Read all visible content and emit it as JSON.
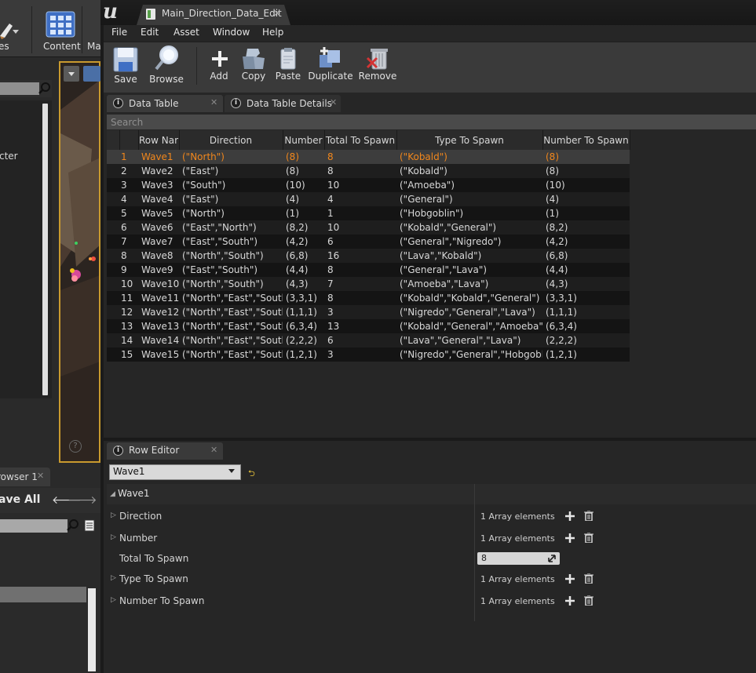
{
  "background_editor": {
    "toolbar_left_label": "es",
    "content_label": "Content",
    "ma_label": "Ma",
    "outliner_text": "cter",
    "viewport_help": "?",
    "browser_tab_label": "rowser 1",
    "browser_tab_close": "✕",
    "save_all_label": "ave All",
    "nav_back": "🡐",
    "nav_forward": "🡒"
  },
  "window": {
    "document_tab_title": "Main_Direction_Data_Edit",
    "document_tab_close": "✕"
  },
  "menu": [
    "File",
    "Edit",
    "Asset",
    "Window",
    "Help"
  ],
  "toolbar": {
    "save": "Save",
    "browse": "Browse",
    "add": "Add",
    "copy": "Copy",
    "paste": "Paste",
    "duplicate": "Duplicate",
    "remove": "Remove"
  },
  "panel_tabs": [
    {
      "label": "Data Table",
      "close": "✕"
    },
    {
      "label": "Data Table Details",
      "close": "✕"
    }
  ],
  "search": {
    "placeholder": "Search"
  },
  "table": {
    "columns": [
      "",
      "",
      "Row Nar",
      "Direction",
      "Number",
      "Total To Spawn",
      "Type To Spawn",
      "Number To Spawn"
    ],
    "rows": [
      [
        "1",
        "Wave1",
        "(\"North\")",
        "(8)",
        "8",
        "(\"Kobald\")",
        "(8)"
      ],
      [
        "2",
        "Wave2",
        "(\"East\")",
        "(8)",
        "8",
        "(\"Kobald\")",
        "(8)"
      ],
      [
        "3",
        "Wave3",
        "(\"South\")",
        "(10)",
        "10",
        "(\"Amoeba\")",
        "(10)"
      ],
      [
        "4",
        "Wave4",
        "(\"East\")",
        "(4)",
        "4",
        "(\"General\")",
        "(4)"
      ],
      [
        "5",
        "Wave5",
        "(\"North\")",
        "(1)",
        "1",
        "(\"Hobgoblin\")",
        "(1)"
      ],
      [
        "6",
        "Wave6",
        "(\"East\",\"North\")",
        "(8,2)",
        "10",
        "(\"Kobald\",\"General\")",
        "(8,2)"
      ],
      [
        "7",
        "Wave7",
        "(\"East\",\"South\")",
        "(4,2)",
        "6",
        "(\"General\",\"Nigredo\")",
        "(4,2)"
      ],
      [
        "8",
        "Wave8",
        "(\"North\",\"South\")",
        "(6,8)",
        "16",
        "(\"Lava\",\"Kobald\")",
        "(6,8)"
      ],
      [
        "9",
        "Wave9",
        "(\"East\",\"South\")",
        "(4,4)",
        "8",
        "(\"General\",\"Lava\")",
        "(4,4)"
      ],
      [
        "10",
        "Wave10",
        "(\"North\",\"South\")",
        "(4,3)",
        "7",
        "(\"Amoeba\",\"Lava\")",
        "(4,3)"
      ],
      [
        "11",
        "Wave11",
        "(\"North\",\"East\",\"South\")",
        "(3,3,1)",
        "8",
        "(\"Kobald\",\"Kobald\",\"General\")",
        "(3,3,1)"
      ],
      [
        "12",
        "Wave12",
        "(\"North\",\"East\",\"South\")",
        "(1,1,1)",
        "3",
        "(\"Nigredo\",\"General\",\"Lava\")",
        "(1,1,1)"
      ],
      [
        "13",
        "Wave13",
        "(\"North\",\"East\",\"South\")",
        "(6,3,4)",
        "13",
        "(\"Kobald\",\"General\",\"Amoeba\")",
        "(6,3,4)"
      ],
      [
        "14",
        "Wave14",
        "(\"North\",\"East\",\"South\")",
        "(2,2,2)",
        "6",
        "(\"Lava\",\"General\",\"Lava\")",
        "(2,2,2)"
      ],
      [
        "15",
        "Wave15",
        "(\"North\",\"East\",\"South\")",
        "(1,2,1)",
        "3",
        "(\"Nigredo\",\"General\",\"Hobgoblin\")",
        "(1,2,1)"
      ]
    ],
    "selected_row_index": 0
  },
  "row_editor": {
    "tab_label": "Row Editor",
    "tab_close": "✕",
    "selected_row": "Wave1",
    "reset_glyph": "⮌",
    "group_label": "Wave1",
    "properties": [
      {
        "name": "Direction",
        "value": "1 Array elements"
      },
      {
        "name": "Number",
        "value": "1 Array elements"
      },
      {
        "name": "Total To Spawn",
        "value": "8"
      },
      {
        "name": "Type To Spawn",
        "value": "1 Array elements"
      },
      {
        "name": "Number To Spawn",
        "value": "1 Array elements"
      }
    ]
  },
  "colors": {
    "selected_row_text": "#f1871c",
    "accent_viewport_border": "#c99a2e",
    "panel_bg": "#262626"
  }
}
